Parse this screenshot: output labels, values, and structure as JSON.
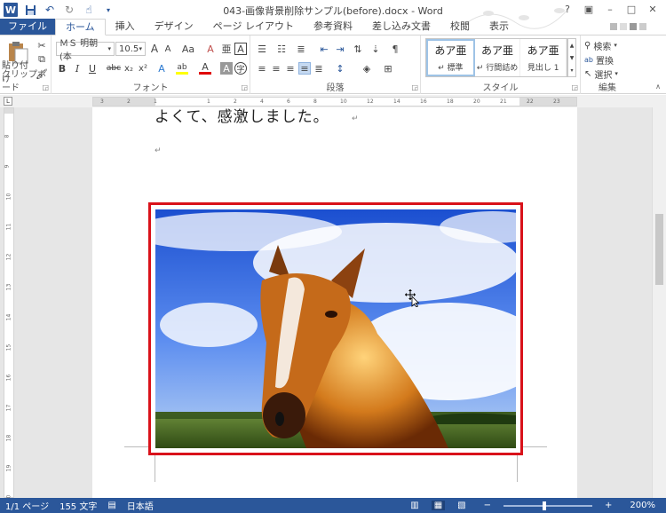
{
  "window": {
    "title": "043-画像背景削除サンプル(before).docx - Word",
    "app_icon": "W",
    "controls": [
      "?",
      "▣",
      "–",
      "□",
      "✕"
    ]
  },
  "quick_access": {
    "icons": [
      "save-icon",
      "undo-icon",
      "redo-icon",
      "touch-mode-icon",
      "customize-icon"
    ]
  },
  "tabs": [
    {
      "label": "ファイル"
    },
    {
      "label": "ホーム"
    },
    {
      "label": "挿入"
    },
    {
      "label": "デザイン"
    },
    {
      "label": "ページ レイアウト"
    },
    {
      "label": "参考資料"
    },
    {
      "label": "差し込み文書"
    },
    {
      "label": "校閲"
    },
    {
      "label": "表示"
    }
  ],
  "ribbon": {
    "clipboard": {
      "label": "クリップボード",
      "paste": "貼り付け"
    },
    "font": {
      "label": "フォント",
      "font_name": "ＭＳ 明朝 (本",
      "font_size": "10.5",
      "bold": "B",
      "italic": "I",
      "underline": "U",
      "strike": "abc",
      "sub": "x₂",
      "sup": "x²",
      "grow": "A",
      "shrink": "A",
      "case": "Aa",
      "clear": "A",
      "char_border": "A",
      "effects": "A",
      "highlight": "ab",
      "color": "A",
      "shade": "A",
      "circle": "字"
    },
    "paragraph": {
      "label": "段落"
    },
    "styles": {
      "label": "スタイル",
      "items": [
        {
          "sample": "あア亜",
          "name": "↵ 標準"
        },
        {
          "sample": "あア亜",
          "name": "↵ 行間詰め"
        },
        {
          "sample": "あア亜",
          "name": "見出し 1"
        }
      ]
    },
    "editing": {
      "label": "編集",
      "find": "検索",
      "replace": "置換",
      "select": "選択"
    }
  },
  "document": {
    "text_line": "よくて、感激しました。",
    "para_mark": "↵"
  },
  "ruler": {
    "h_ticks": [
      "3",
      "2",
      "1",
      "",
      "1",
      "2",
      "4",
      "6",
      "8",
      "10",
      "12",
      "14",
      "16",
      "18",
      "20",
      "21",
      "22",
      "23"
    ],
    "v_ticks": [
      "8",
      "9",
      "10",
      "11",
      "12",
      "13",
      "14",
      "15",
      "16",
      "17",
      "18",
      "19",
      "20"
    ]
  },
  "statusbar": {
    "page": "1/1 ページ",
    "words": "155 文字",
    "lang": "日本語",
    "zoom": "200%",
    "zoom_minus": "−",
    "zoom_plus": "+"
  },
  "colors": {
    "accent": "#2b579a",
    "selection_border": "#d9121a"
  }
}
